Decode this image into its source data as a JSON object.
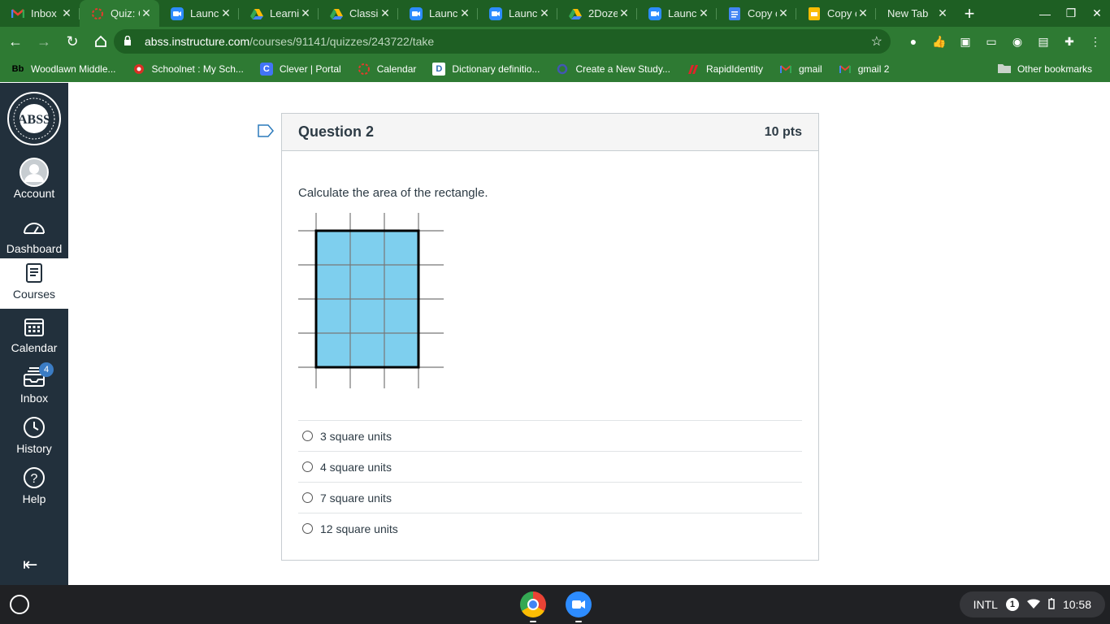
{
  "browser": {
    "tabs": [
      {
        "label": "Inbox",
        "icon": "gmail-icon"
      },
      {
        "label": "Quiz: C",
        "icon": "canvas-icon",
        "active": true
      },
      {
        "label": "Launc",
        "icon": "zoom-icon"
      },
      {
        "label": "Learni",
        "icon": "drive-icon"
      },
      {
        "label": "Classi",
        "icon": "drive-icon"
      },
      {
        "label": "Launc",
        "icon": "zoom-icon"
      },
      {
        "label": "Launc",
        "icon": "zoom-icon"
      },
      {
        "label": "2Doze",
        "icon": "drive-icon"
      },
      {
        "label": "Launc",
        "icon": "zoom-icon"
      },
      {
        "label": "Copy c",
        "icon": "docs-icon"
      },
      {
        "label": "Copy c",
        "icon": "slides-icon"
      },
      {
        "label": "New Tab",
        "icon": ""
      }
    ],
    "url_host": "abss.instructure.com",
    "url_path": "/courses/91141/quizzes/243722/take",
    "bookmarks": [
      {
        "label": "Woodlawn Middle...",
        "icon": "blackboard-icon"
      },
      {
        "label": "Schoolnet : My Sch...",
        "icon": "schoolnet-icon"
      },
      {
        "label": "Clever | Portal",
        "icon": "clever-icon"
      },
      {
        "label": "Calendar",
        "icon": "canvas-icon"
      },
      {
        "label": "Dictionary definitio...",
        "icon": "dictionary-icon"
      },
      {
        "label": "Create a New Study...",
        "icon": "quizlet-icon"
      },
      {
        "label": "RapidIdentity",
        "icon": "rapididentity-icon"
      },
      {
        "label": "gmail",
        "icon": "gmail-icon"
      },
      {
        "label": "gmail 2",
        "icon": "gmail-icon"
      }
    ],
    "other_bookmarks": "Other bookmarks"
  },
  "sidebar": {
    "items": [
      {
        "label": "Account"
      },
      {
        "label": "Dashboard"
      },
      {
        "label": "Courses"
      },
      {
        "label": "Calendar"
      },
      {
        "label": "Inbox",
        "badge": "4"
      },
      {
        "label": "History"
      },
      {
        "label": "Help"
      }
    ]
  },
  "question": {
    "title": "Question 2",
    "points": "10 pts",
    "text": "Calculate the area of the rectangle.",
    "figure": {
      "shaded_columns": 3,
      "shaded_rows": 4,
      "fill_color": "#7ecfee"
    },
    "answers": [
      {
        "label": "3 square units"
      },
      {
        "label": "4 square units"
      },
      {
        "label": "7 square units"
      },
      {
        "label": "12 square units"
      }
    ]
  },
  "shelf": {
    "input_method": "INTL",
    "notification_count": "1",
    "time": "10:58"
  }
}
